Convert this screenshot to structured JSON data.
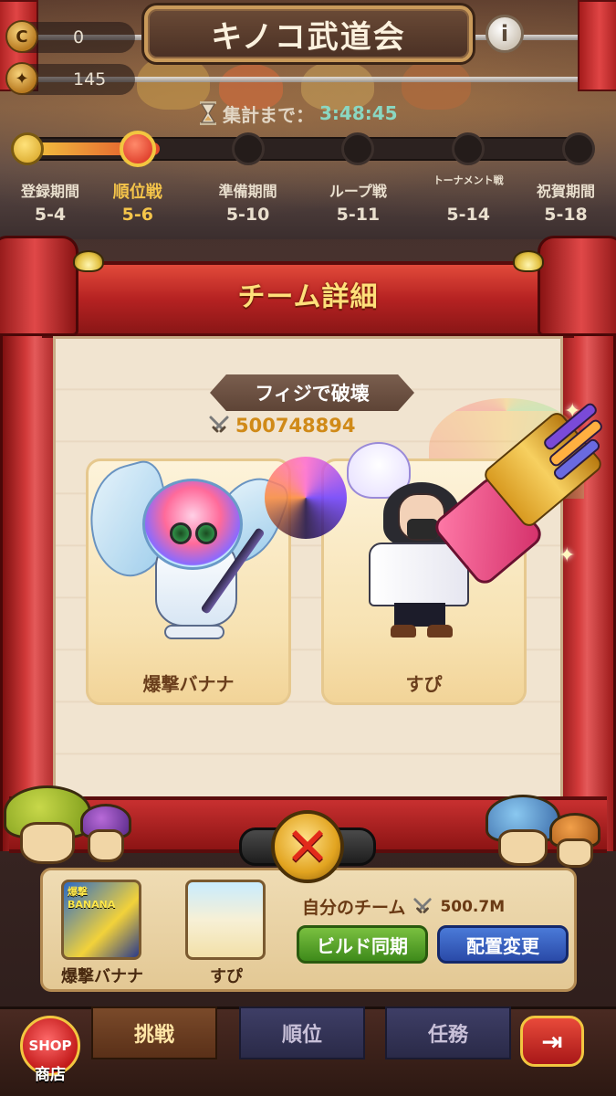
{
  "header": {
    "title": "キノコ武道会",
    "info_icon": "info-icon",
    "currencies": [
      {
        "icon": "coin-c-icon",
        "value": "0"
      },
      {
        "icon": "ticket-icon",
        "value": "145"
      }
    ],
    "timer_label": "集計まで：",
    "timer_value": "3:48:45"
  },
  "schedule": {
    "progress_fraction": 0.24,
    "stages": [
      {
        "label": "登録期間",
        "date": "5-4",
        "state": "done"
      },
      {
        "label": "順位戦",
        "date": "5-6",
        "state": "current"
      },
      {
        "label": "準備期間",
        "date": "5-10",
        "state": "upcoming"
      },
      {
        "label": "ループ戦",
        "date": "5-11",
        "state": "upcoming"
      },
      {
        "label": "トーナメント戦",
        "date": "5-14",
        "state": "upcoming"
      },
      {
        "label": "祝賀期間",
        "date": "5-18",
        "state": "upcoming"
      }
    ]
  },
  "detail": {
    "title": "チーム詳細",
    "team_name": "フィジで破壊",
    "power": "500748894",
    "members": [
      {
        "name": "爆撃バナナ"
      },
      {
        "name": "すぴ"
      }
    ],
    "close_icon": "close-x-icon"
  },
  "own_team": {
    "label": "自分のチーム",
    "power": "500.7M",
    "members": [
      {
        "name": "爆撃バナナ",
        "thumb_text": "爆撃 BANANA"
      },
      {
        "name": "すぴ"
      }
    ],
    "sync_button": "ビルド同期",
    "arrange_button": "配置変更"
  },
  "nav": {
    "shop_badge": "SHOP",
    "shop_label": "商店",
    "tabs": [
      {
        "label": "挑戦",
        "active": true
      },
      {
        "label": "順位",
        "active": false
      },
      {
        "label": "任務",
        "active": false
      }
    ],
    "exit_icon": "exit-icon"
  },
  "colors": {
    "frame_red": "#c83030",
    "gold": "#f4c44a",
    "panel": "#f1e4d0"
  }
}
